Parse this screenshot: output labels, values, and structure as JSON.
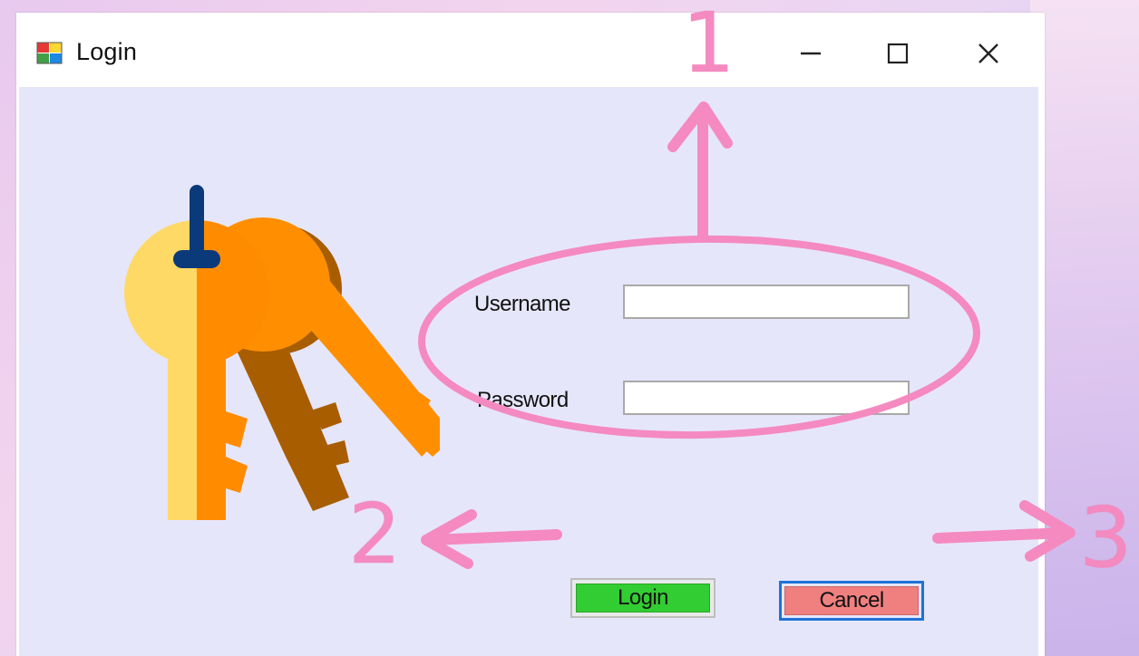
{
  "window": {
    "title": "Login",
    "controls": [
      "minimize",
      "maximize",
      "close"
    ]
  },
  "form": {
    "username_label": "Username",
    "username_value": "",
    "password_label": "Password",
    "password_value": "",
    "login_label": "Login",
    "cancel_label": "Cancel"
  },
  "annotations": {
    "one": "1",
    "two": "2",
    "three": "3"
  },
  "icons": {
    "app": "app-icon",
    "illustration": "keys-icon",
    "minimize": "minimize-icon",
    "maximize": "maximize-icon",
    "close": "close-icon"
  },
  "colors": {
    "client_bg": "#e6e6fa",
    "login_button": "#32cd32",
    "cancel_button": "#f08080",
    "annotation": "#f48ac0"
  }
}
